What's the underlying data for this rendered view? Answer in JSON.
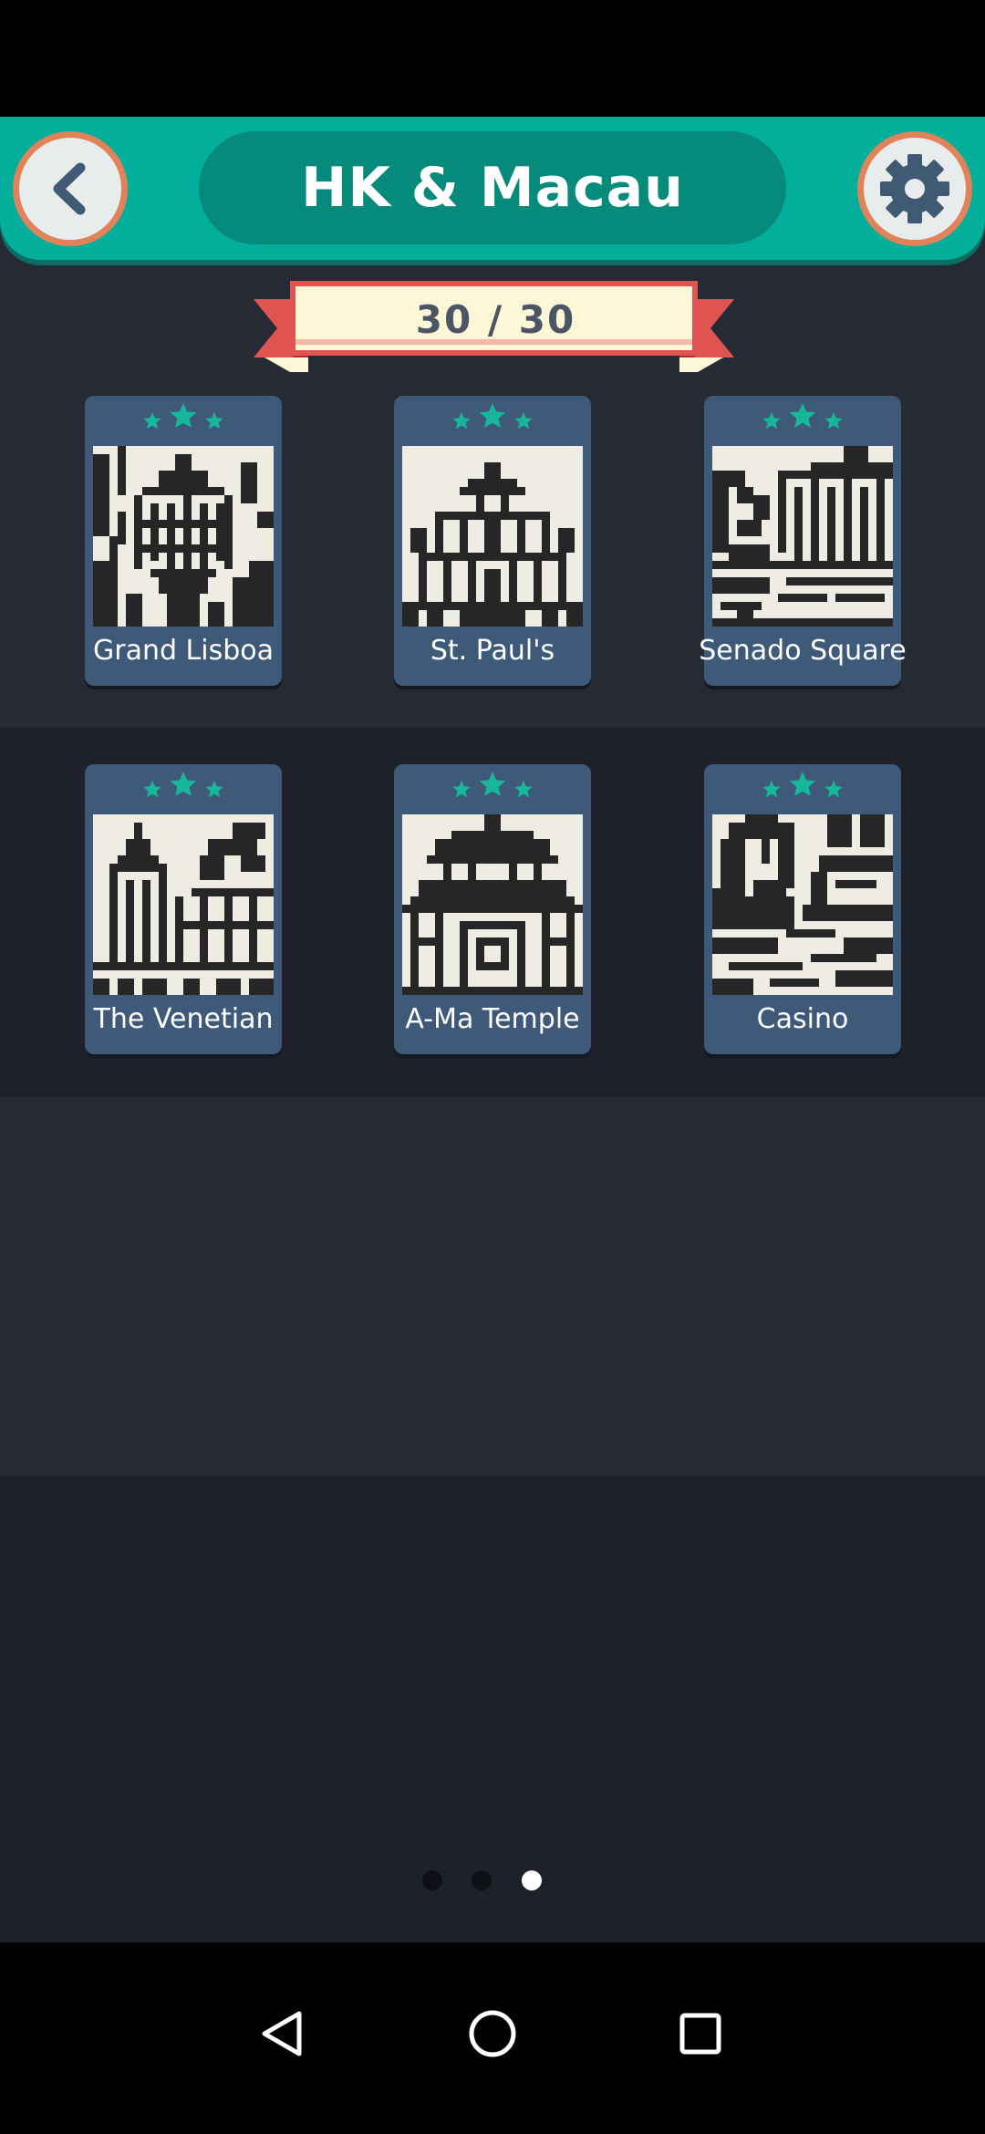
{
  "header": {
    "title": "HK & Macau",
    "back_icon": "chevron-left-icon",
    "settings_icon": "gear-icon"
  },
  "progress": {
    "label": "30 / 30",
    "completed": 30,
    "total": 30
  },
  "levels": [
    {
      "name": "Grand Lisboa",
      "stars": 3,
      "icon": "grand-lisboa-pixel-art"
    },
    {
      "name": "St. Paul's",
      "stars": 3,
      "icon": "st-pauls-pixel-art"
    },
    {
      "name": "Senado Square",
      "stars": 3,
      "icon": "senado-square-pixel-art"
    },
    {
      "name": "The Venetian",
      "stars": 3,
      "icon": "the-venetian-pixel-art"
    },
    {
      "name": "A-Ma Temple",
      "stars": 3,
      "icon": "a-ma-temple-pixel-art"
    },
    {
      "name": "Casino",
      "stars": 3,
      "icon": "casino-pixel-art"
    }
  ],
  "pagination": {
    "pages": 3,
    "current": 3
  },
  "nav": {
    "back": "nav-back-icon",
    "home": "nav-home-icon",
    "recents": "nav-recents-icon"
  },
  "colors": {
    "accent": "#03ae9a",
    "accent_dark": "#068a7c",
    "card": "#3f5a78",
    "star": "#17b79c",
    "ribbon": "#fdf6d7",
    "ribbon_edge": "#e05452"
  }
}
